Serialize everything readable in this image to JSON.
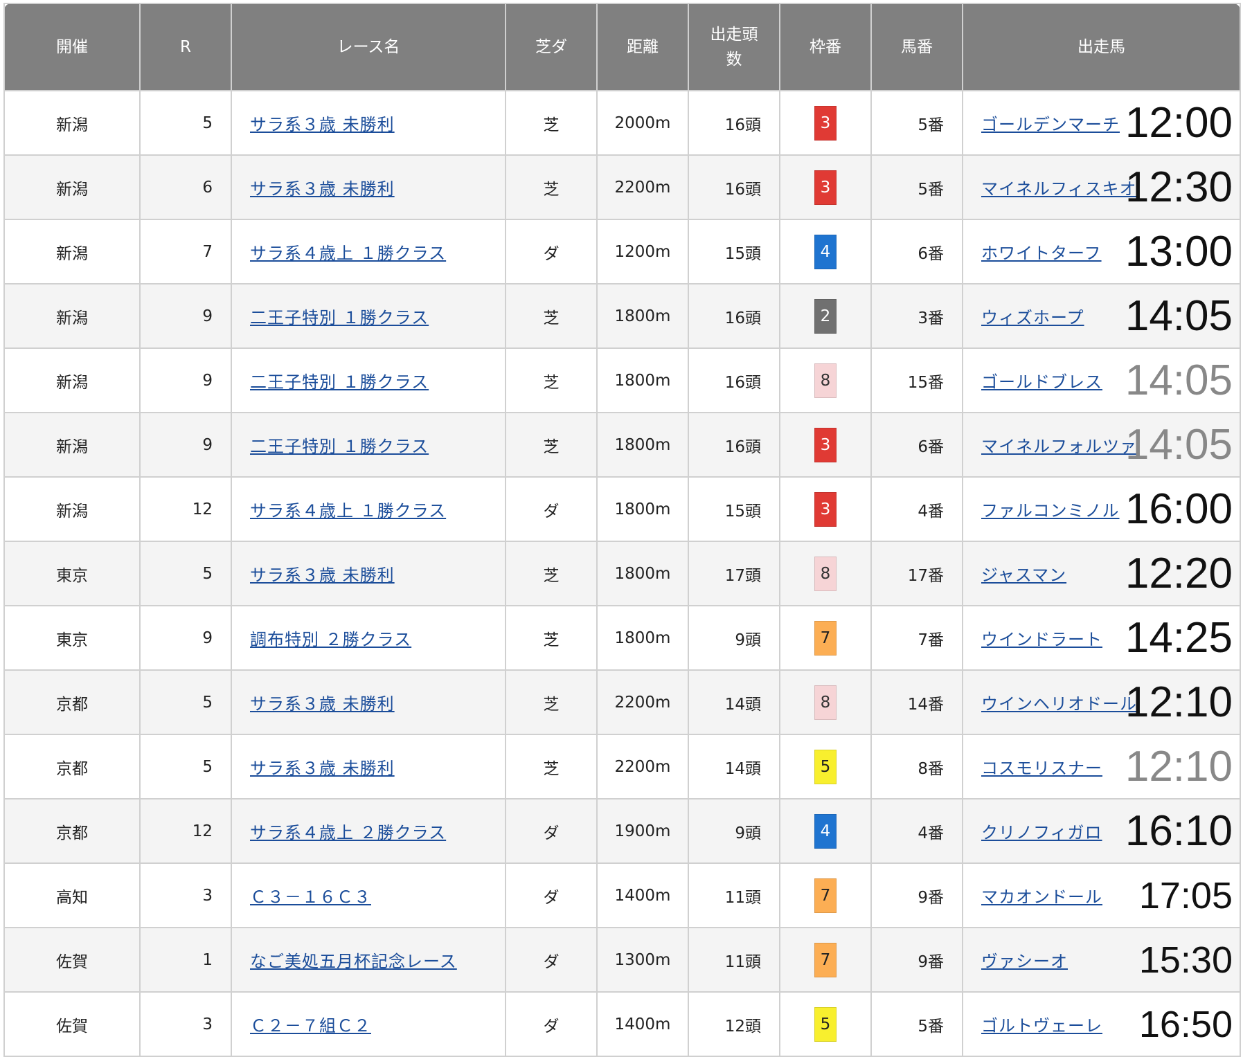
{
  "headers": [
    "開催",
    "R",
    "レース名",
    "芝ダ",
    "距離",
    "出走頭数",
    "枠番",
    "馬番",
    "出走馬"
  ],
  "header_split": {
    "line1": "出走頭",
    "line2": "数"
  },
  "gate_colors": {
    "2": {
      "bg": "#707070",
      "fg": "#ffffff"
    },
    "3": {
      "bg": "#e03a34",
      "fg": "#ffffff"
    },
    "4": {
      "bg": "#1f74d0",
      "fg": "#ffffff"
    },
    "5": {
      "bg": "#f8ef2e",
      "fg": "#222222"
    },
    "7": {
      "bg": "#fcae54",
      "fg": "#222222"
    },
    "8": {
      "bg": "#f6d4d6",
      "fg": "#333333"
    }
  },
  "rows": [
    {
      "venue": "新潟",
      "r": "5",
      "race": "サラ系３歳 未勝利",
      "surface": "芝",
      "distance": "2000m",
      "runners": "16頭",
      "gate": "3",
      "number": "5番",
      "horse": "ゴールデンマーチ",
      "time": "12:00",
      "muted": false,
      "small": false
    },
    {
      "venue": "新潟",
      "r": "6",
      "race": "サラ系３歳 未勝利",
      "surface": "芝",
      "distance": "2200m",
      "runners": "16頭",
      "gate": "3",
      "number": "5番",
      "horse": "マイネルフィスキオ",
      "time": "12:30",
      "muted": false,
      "small": false
    },
    {
      "venue": "新潟",
      "r": "7",
      "race": "サラ系４歳上 １勝クラス",
      "surface": "ダ",
      "distance": "1200m",
      "runners": "15頭",
      "gate": "4",
      "number": "6番",
      "horse": "ホワイトターフ",
      "time": "13:00",
      "muted": false,
      "small": false
    },
    {
      "venue": "新潟",
      "r": "9",
      "race": "二王子特別 １勝クラス",
      "surface": "芝",
      "distance": "1800m",
      "runners": "16頭",
      "gate": "2",
      "number": "3番",
      "horse": "ウィズホープ",
      "time": "14:05",
      "muted": false,
      "small": false
    },
    {
      "venue": "新潟",
      "r": "9",
      "race": "二王子特別 １勝クラス",
      "surface": "芝",
      "distance": "1800m",
      "runners": "16頭",
      "gate": "8",
      "number": "15番",
      "horse": "ゴールドブレス",
      "time": "14:05",
      "muted": true,
      "small": false
    },
    {
      "venue": "新潟",
      "r": "9",
      "race": "二王子特別 １勝クラス",
      "surface": "芝",
      "distance": "1800m",
      "runners": "16頭",
      "gate": "3",
      "number": "6番",
      "horse": "マイネルフォルツァ",
      "time": "14:05",
      "muted": true,
      "small": false
    },
    {
      "venue": "新潟",
      "r": "12",
      "race": "サラ系４歳上 １勝クラス",
      "surface": "ダ",
      "distance": "1800m",
      "runners": "15頭",
      "gate": "3",
      "number": "4番",
      "horse": "ファルコンミノル",
      "time": "16:00",
      "muted": false,
      "small": false
    },
    {
      "venue": "東京",
      "r": "5",
      "race": "サラ系３歳 未勝利",
      "surface": "芝",
      "distance": "1800m",
      "runners": "17頭",
      "gate": "8",
      "number": "17番",
      "horse": "ジャスマン",
      "time": "12:20",
      "muted": false,
      "small": false
    },
    {
      "venue": "東京",
      "r": "9",
      "race": "調布特別 ２勝クラス",
      "surface": "芝",
      "distance": "1800m",
      "runners": "9頭",
      "gate": "7",
      "number": "7番",
      "horse": "ウインドラート",
      "time": "14:25",
      "muted": false,
      "small": false
    },
    {
      "venue": "京都",
      "r": "5",
      "race": "サラ系３歳 未勝利",
      "surface": "芝",
      "distance": "2200m",
      "runners": "14頭",
      "gate": "8",
      "number": "14番",
      "horse": "ウインヘリオドール",
      "time": "12:10",
      "muted": false,
      "small": false
    },
    {
      "venue": "京都",
      "r": "5",
      "race": "サラ系３歳 未勝利",
      "surface": "芝",
      "distance": "2200m",
      "runners": "14頭",
      "gate": "5",
      "number": "8番",
      "horse": "コスモリスナー",
      "time": "12:10",
      "muted": true,
      "small": false
    },
    {
      "venue": "京都",
      "r": "12",
      "race": "サラ系４歳上 ２勝クラス",
      "surface": "ダ",
      "distance": "1900m",
      "runners": "9頭",
      "gate": "4",
      "number": "4番",
      "horse": "クリノフィガロ",
      "time": "16:10",
      "muted": false,
      "small": false
    },
    {
      "venue": "高知",
      "r": "3",
      "race": "Ｃ３－１６Ｃ３",
      "surface": "ダ",
      "distance": "1400m",
      "runners": "11頭",
      "gate": "7",
      "number": "9番",
      "horse": "マカオンドール",
      "time": "17:05",
      "muted": false,
      "small": true
    },
    {
      "venue": "佐賀",
      "r": "1",
      "race": "なご美処五月杯記念レース",
      "surface": "ダ",
      "distance": "1300m",
      "runners": "11頭",
      "gate": "7",
      "number": "9番",
      "horse": "ヴァシーオ",
      "time": "15:30",
      "muted": false,
      "small": true
    },
    {
      "venue": "佐賀",
      "r": "3",
      "race": "Ｃ２－７組Ｃ２",
      "surface": "ダ",
      "distance": "1400m",
      "runners": "12頭",
      "gate": "5",
      "number": "5番",
      "horse": "ゴルトヴェーレ",
      "time": "16:50",
      "muted": false,
      "small": true
    }
  ]
}
